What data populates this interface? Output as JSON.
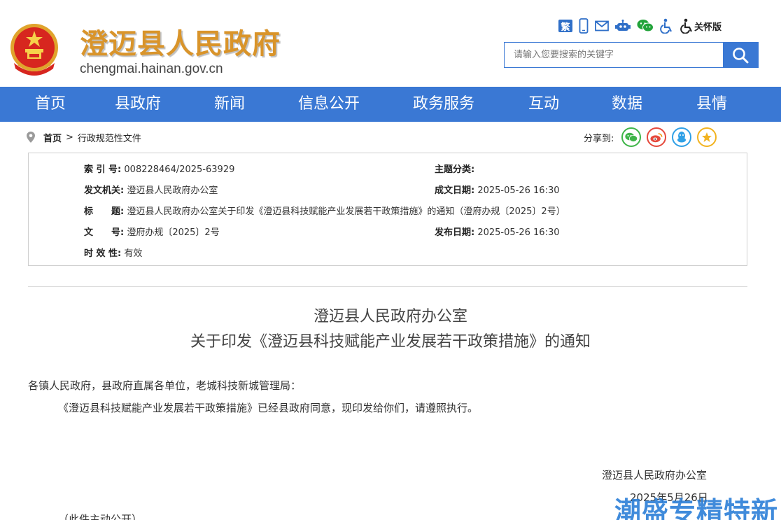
{
  "header": {
    "site_title": "澄迈县人民政府",
    "site_url": "chengmai.hainan.gov.cn",
    "tools": {
      "fan_label": "繁",
      "care_label": "关怀版"
    },
    "search": {
      "placeholder": "请输入您要搜索的关键字"
    }
  },
  "nav": {
    "items": [
      "首页",
      "县政府",
      "新闻",
      "信息公开",
      "政务服务",
      "互动",
      "数据",
      "县情"
    ]
  },
  "breadcrumb": {
    "home": "首页",
    "separator": ">",
    "current": "行政规范性文件"
  },
  "share": {
    "label": "分享到:"
  },
  "meta": {
    "index_label": "索 引 号:",
    "index_value": "008228464/2025-63929",
    "topic_label": "主题分类:",
    "topic_value": "",
    "issuer_label": "发文机关:",
    "issuer_value": "澄迈县人民政府办公室",
    "created_label": "成文日期:",
    "created_value": "2025-05-26 16:30",
    "title_label": "标　　题:",
    "title_value": "澄迈县人民政府办公室关于印发《澄迈县科技赋能产业发展若干政策措施》的通知（澄府办规〔2025〕2号）",
    "docno_label": "文　　号:",
    "docno_value": "澄府办规〔2025〕2号",
    "published_label": "发布日期:",
    "published_value": "2025-05-26 16:30",
    "validity_label": "时 效 性:",
    "validity_value": "有效"
  },
  "article": {
    "title_line1": "澄迈县人民政府办公室",
    "title_line2": "关于印发《澄迈县科技赋能产业发展若干政策措施》的通知",
    "salutation": "各镇人民政府，县政府直属各单位，老城科技新城管理局：",
    "body": "《澄迈县科技赋能产业发展若干政策措施》已经县政府同意，现印发给你们，请遵照执行。",
    "sign_org": "澄迈县人民政府办公室",
    "sign_date": "2025年5月26日",
    "disclosure": "（此件主动公开）"
  },
  "watermark": "潮盛专精特新",
  "colors": {
    "primary_blue": "#3a78d4",
    "title_gold": "#d9942a",
    "emblem_red": "#d7261f"
  }
}
